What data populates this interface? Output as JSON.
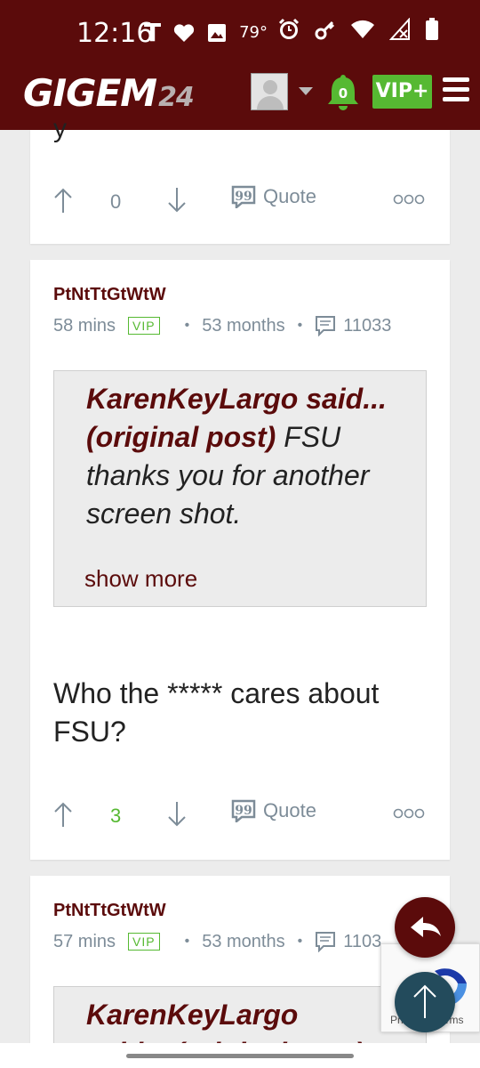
{
  "status_bar": {
    "time": "12:16",
    "carrier_glyph": "T",
    "temperature": "79°",
    "icons": [
      "heart-icon",
      "image-icon",
      "alarm-icon",
      "key-icon",
      "wifi-icon",
      "no-signal-icon",
      "battery-icon"
    ]
  },
  "header": {
    "logo_text": "GIGEM",
    "logo_number": "24",
    "notification_count": "0",
    "vip_button": "VIP+",
    "colors": {
      "brand": "#5b0b0b",
      "green": "#56b932"
    }
  },
  "posts": [
    {
      "truncated_text": "y",
      "votes": "0",
      "quote_label": "Quote"
    },
    {
      "username": "PtNtTtGtWtW",
      "time_ago": "58 mins",
      "badge": "VIP",
      "tenure": "53 months",
      "post_count": "11033",
      "quote": {
        "author_line": "KarenKeyLargo said... (original post)",
        "text": "FSU thanks you for another screen shot.",
        "show_more": "show more"
      },
      "body": "Who the ***** cares about FSU?",
      "votes": "3",
      "quote_label": "Quote"
    },
    {
      "username": "PtNtTtGtWtW",
      "time_ago": "57 mins",
      "badge": "VIP",
      "tenure": "53 months",
      "post_count": "1103",
      "quote_author": "KarenKeyLargo",
      "quote_author_line2": "said... (original post)"
    }
  ],
  "recaptcha": {
    "label": "Privacy - Terms"
  }
}
